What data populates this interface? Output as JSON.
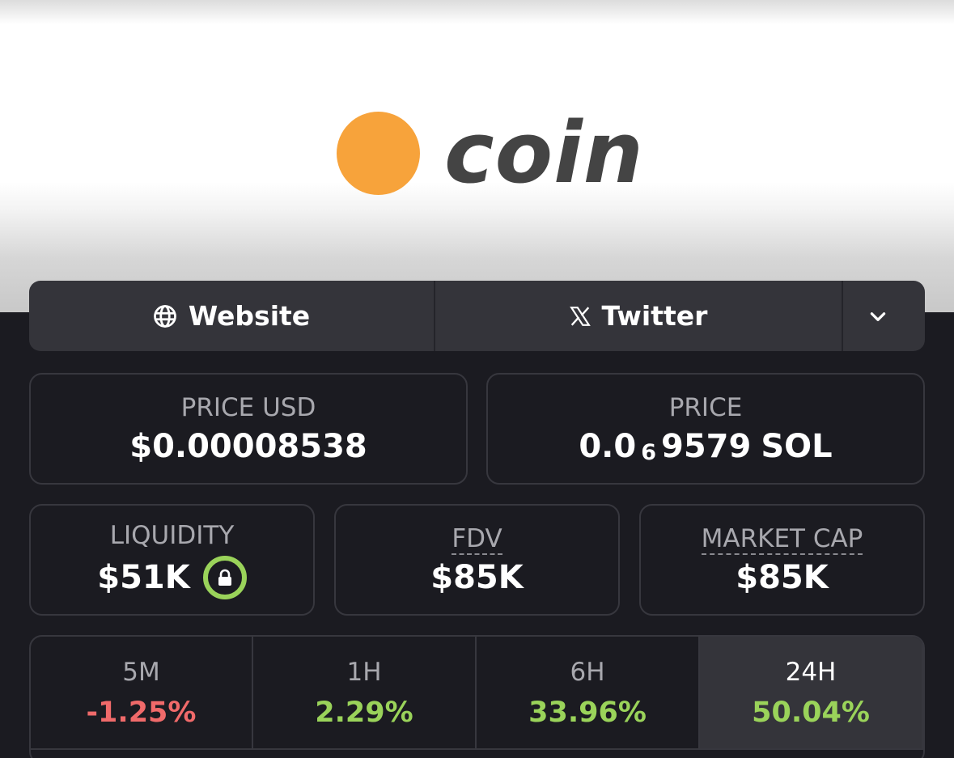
{
  "header": {
    "logo_text": "coin",
    "logo_color": "#f7a33b"
  },
  "links": {
    "website": "Website",
    "twitter": "Twitter",
    "more_icon": "chevron-down-icon"
  },
  "price_usd": {
    "label": "PRICE USD",
    "value": "$0.00008538"
  },
  "price_native": {
    "label": "PRICE",
    "prefix": "0.0",
    "zeros": "6",
    "digits": "9579",
    "unit": "SOL"
  },
  "liquidity": {
    "label": "LIQUIDITY",
    "value": "$51K",
    "lock_icon": "lock-icon"
  },
  "fdv": {
    "label": "FDV",
    "value": "$85K"
  },
  "market_cap": {
    "label": "MARKET CAP",
    "value": "$85K"
  },
  "timeframes": [
    {
      "label": "5M",
      "change": "-1.25%",
      "color": "#f06a6a"
    },
    {
      "label": "1H",
      "change": "2.29%",
      "color": "#9ad35a"
    },
    {
      "label": "6H",
      "change": "33.96%",
      "color": "#9ad35a"
    },
    {
      "label": "24H",
      "change": "50.04%",
      "color": "#9ad35a"
    }
  ]
}
